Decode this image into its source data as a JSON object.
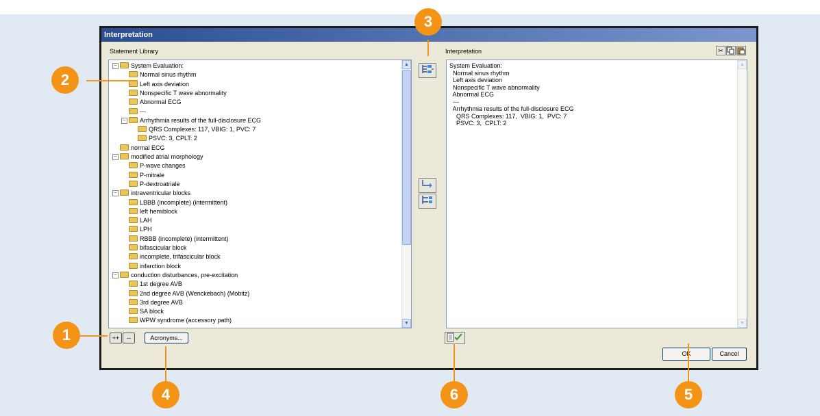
{
  "window": {
    "title": "Interpretation"
  },
  "library": {
    "label": "Statement Library",
    "items": [
      {
        "text": "System Evaluation:",
        "level": 0,
        "expander": "minus",
        "open": true
      },
      {
        "text": "Normal sinus rhythm",
        "level": 1
      },
      {
        "text": "Left axis deviation",
        "level": 1
      },
      {
        "text": "Nonspecific T wave abnormality",
        "level": 1
      },
      {
        "text": "Abnormal ECG",
        "level": 1
      },
      {
        "text": "---",
        "level": 1
      },
      {
        "text": "Arrhythmia results of the full-disclosure ECG",
        "level": 1,
        "expander": "minus"
      },
      {
        "text": "QRS Complexes: 117,  VBIG: 1,  PVC: 7",
        "level": 2
      },
      {
        "text": "PSVC: 3,  CPLT: 2",
        "level": 2
      },
      {
        "text": "normal ECG",
        "level": 0
      },
      {
        "text": "modified atrial morphology",
        "level": 0,
        "expander": "minus"
      },
      {
        "text": "P-wave changes",
        "level": 1
      },
      {
        "text": "P-mitrale",
        "level": 1
      },
      {
        "text": "P-dextroatriale",
        "level": 1
      },
      {
        "text": "intraventricular blocks",
        "level": 0,
        "expander": "minus"
      },
      {
        "text": "LBBB (incomplete) (intermittent)",
        "level": 1
      },
      {
        "text": "left hemiblock",
        "level": 1
      },
      {
        "text": "LAH",
        "level": 1
      },
      {
        "text": "LPH",
        "level": 1
      },
      {
        "text": "RBBB (incomplete) (intermittent)",
        "level": 1
      },
      {
        "text": "bifascicular block",
        "level": 1
      },
      {
        "text": "incomplete, trifascicular block",
        "level": 1
      },
      {
        "text": "infarction block",
        "level": 1
      },
      {
        "text": "conduction disturbances, pre-excitation",
        "level": 0,
        "expander": "minus"
      },
      {
        "text": "1st degree AVB",
        "level": 1
      },
      {
        "text": "2nd degree AVB (Wenckebach) (Mobitz)",
        "level": 1
      },
      {
        "text": "3rd degree AVB",
        "level": 1
      },
      {
        "text": "SA block",
        "level": 1
      },
      {
        "text": "WPW syndrome (accessory path)",
        "level": 1
      }
    ]
  },
  "interpretation": {
    "label": "Interpretation",
    "text": "System Evaluation:\n  Normal sinus rhythm\n  Left axis deviation\n  Nonspecific T wave abnormality\n  Abnormal ECG\n  ---\n  Arrhythmia results of the full-disclosure ECG\n    QRS Complexes: 117,  VBIG: 1,  PVC: 7\n    PSVC: 3,  CPLT: 2"
  },
  "buttons": {
    "expand_all": "++",
    "collapse_all": "--",
    "acronyms": "Acronyms...",
    "ok": "OK",
    "cancel": "Cancel"
  },
  "callouts": [
    "1",
    "2",
    "3",
    "4",
    "5",
    "6"
  ],
  "colors": {
    "accent": "#f39417",
    "titlebar": "#2b4e92",
    "background": "#e1e9f2"
  }
}
